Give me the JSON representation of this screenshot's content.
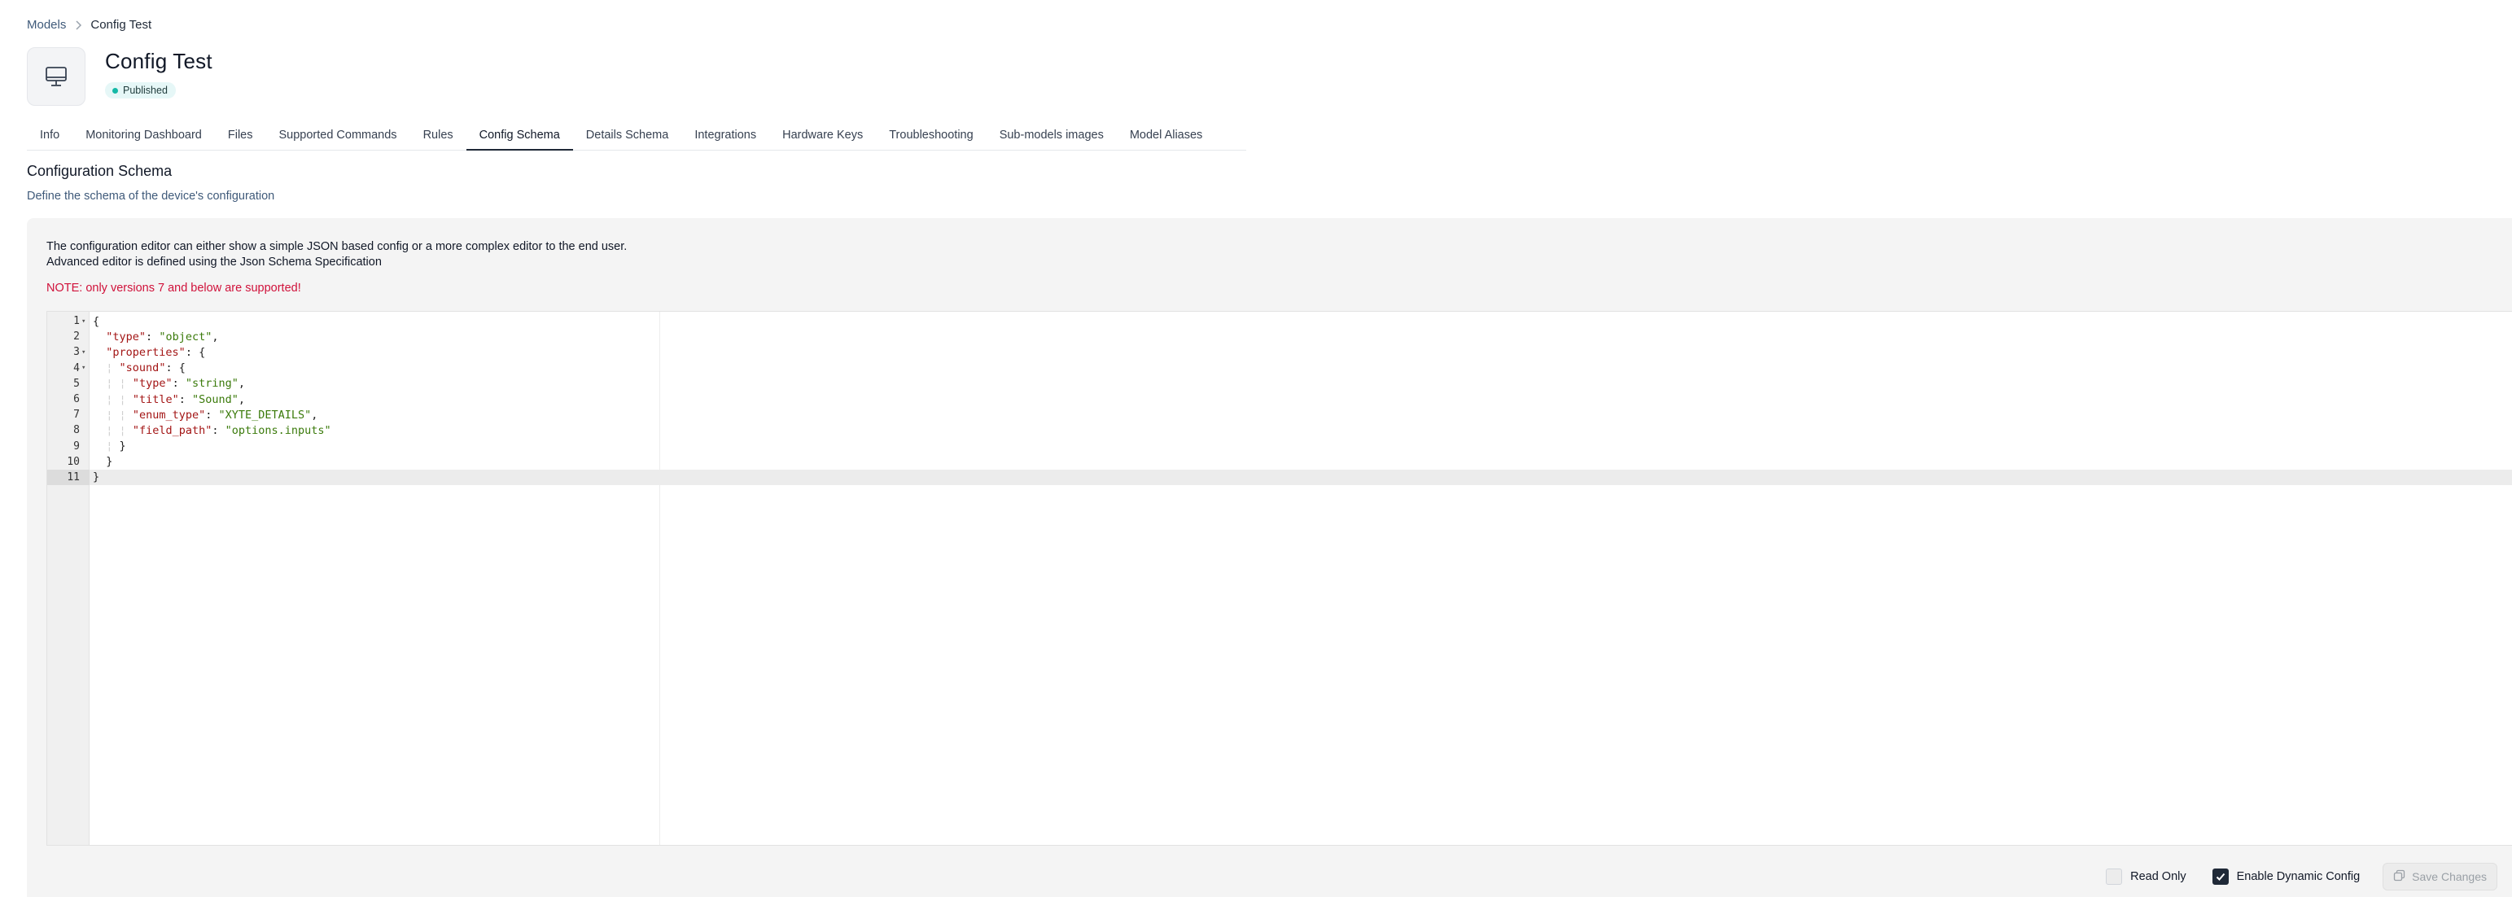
{
  "breadcrumb": {
    "parent": "Models",
    "current": "Config Test"
  },
  "header": {
    "title": "Config Test",
    "status": "Published",
    "icon": "monitor-icon",
    "status_color": "#14b8a6"
  },
  "tabs": [
    {
      "label": "Info"
    },
    {
      "label": "Monitoring Dashboard"
    },
    {
      "label": "Files"
    },
    {
      "label": "Supported Commands"
    },
    {
      "label": "Rules"
    },
    {
      "label": "Config Schema",
      "active": true
    },
    {
      "label": "Details Schema"
    },
    {
      "label": "Integrations"
    },
    {
      "label": "Hardware Keys"
    },
    {
      "label": "Troubleshooting"
    },
    {
      "label": "Sub-models images"
    },
    {
      "label": "Model Aliases"
    }
  ],
  "section": {
    "title": "Configuration Schema",
    "description": "Define the schema of the device's configuration"
  },
  "panel": {
    "line1": "The configuration editor can either show a simple JSON based config or a more complex editor to the end user.",
    "line2": "Advanced editor is defined using the Json Schema Specification",
    "note": "NOTE: only versions 7 and below are supported!",
    "note_color": "#d0113a"
  },
  "editor": {
    "lines": [
      {
        "n": "1",
        "fold": true
      },
      {
        "n": "2"
      },
      {
        "n": "3",
        "fold": true
      },
      {
        "n": "4",
        "fold": true
      },
      {
        "n": "5"
      },
      {
        "n": "6"
      },
      {
        "n": "7"
      },
      {
        "n": "8"
      },
      {
        "n": "9"
      },
      {
        "n": "10"
      },
      {
        "n": "11",
        "active": true
      }
    ],
    "tokens": {
      "type_key": "\"type\"",
      "type_val": "\"object\"",
      "properties_key": "\"properties\"",
      "sound_key": "\"sound\"",
      "sound_type_val": "\"string\"",
      "title_key": "\"title\"",
      "title_val": "\"Sound\"",
      "enum_key": "\"enum_type\"",
      "enum_val": "\"XYTE_DETAILS\"",
      "field_key": "\"field_path\"",
      "field_val": "\"options.inputs\""
    }
  },
  "footer": {
    "read_only_label": "Read Only",
    "read_only_checked": false,
    "dynamic_label": "Enable Dynamic Config",
    "dynamic_checked": true,
    "save_label": "Save Changes"
  }
}
